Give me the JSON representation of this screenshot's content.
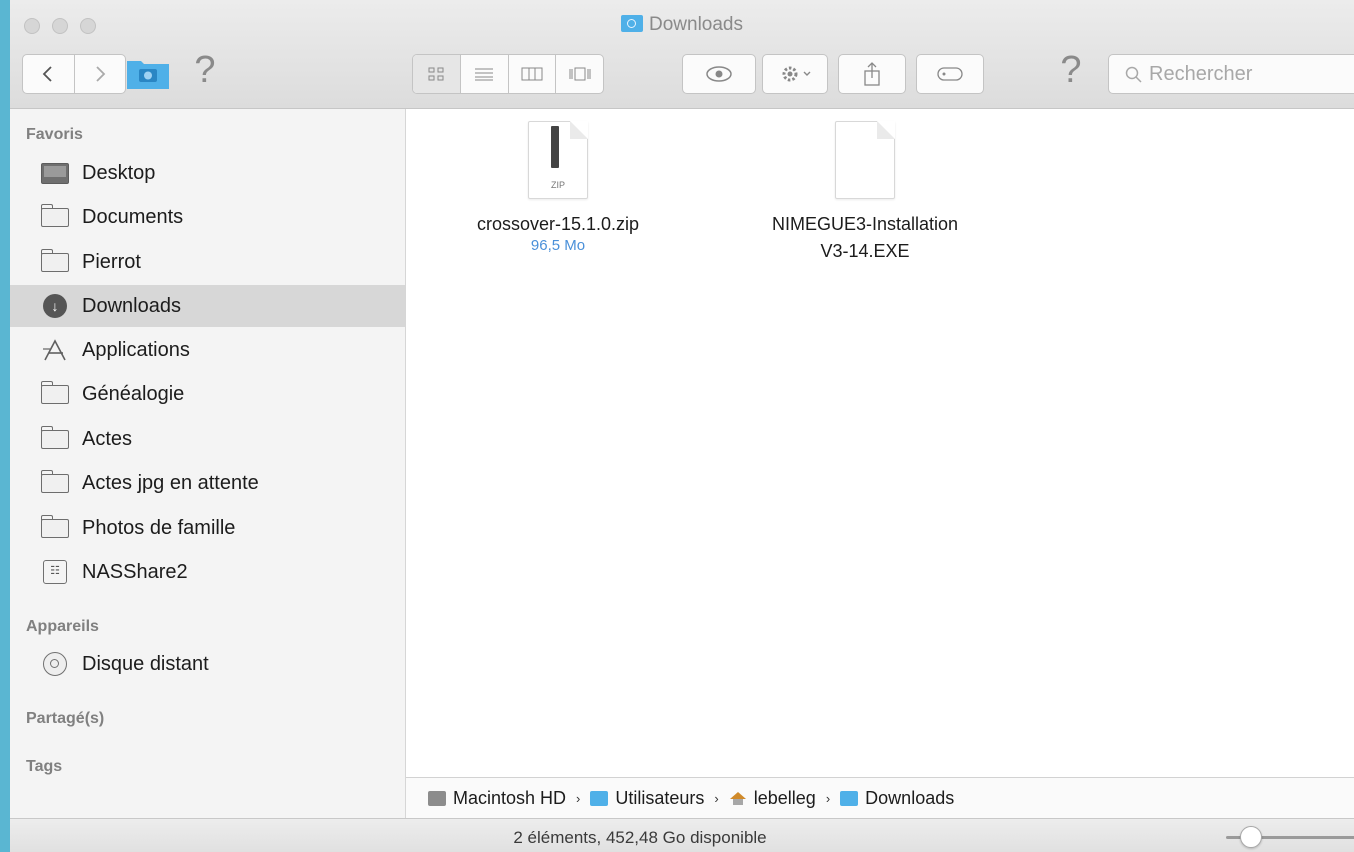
{
  "window": {
    "title": "Downloads"
  },
  "toolbar": {
    "back_icon": "chevron-left",
    "forward_icon": "chevron-right",
    "help_label": "?",
    "search_placeholder": "Rechercher"
  },
  "sidebar": {
    "favorites_heading": "Favoris",
    "favorites": [
      {
        "label": "Desktop",
        "icon": "desktop-icon"
      },
      {
        "label": "Documents",
        "icon": "folder-icon"
      },
      {
        "label": "Pierrot",
        "icon": "folder-icon"
      },
      {
        "label": "Downloads",
        "icon": "downloads-icon",
        "selected": true
      },
      {
        "label": "Applications",
        "icon": "applications-icon"
      },
      {
        "label": "Généalogie",
        "icon": "folder-icon"
      },
      {
        "label": "Actes",
        "icon": "folder-icon"
      },
      {
        "label": "Actes jpg en attente",
        "icon": "folder-icon"
      },
      {
        "label": "Photos de famille",
        "icon": "folder-icon"
      },
      {
        "label": "NASShare2",
        "icon": "nas-icon"
      }
    ],
    "devices_heading": "Appareils",
    "devices": [
      {
        "label": "Disque distant",
        "icon": "disk-icon"
      }
    ],
    "shared_heading": "Partagé(s)",
    "tags_heading": "Tags"
  },
  "files": [
    {
      "name": "crossover-15.1.0.zip",
      "size": "96,5 Mo",
      "type_label": "ZIP"
    },
    {
      "name_line1": "NIMEGUE3-Installation",
      "name_line2": "V3-14.EXE"
    }
  ],
  "pathbar": {
    "items": [
      "Macintosh HD",
      "Utilisateurs",
      "lebelleg",
      "Downloads"
    ],
    "separator": "›"
  },
  "status": {
    "text": "2 éléments, 452,48 Go disponible"
  },
  "colors": {
    "desktop_bg": "#5ab6d2",
    "folder_accent": "#4fb0e8",
    "size_text": "#4a90d9"
  }
}
